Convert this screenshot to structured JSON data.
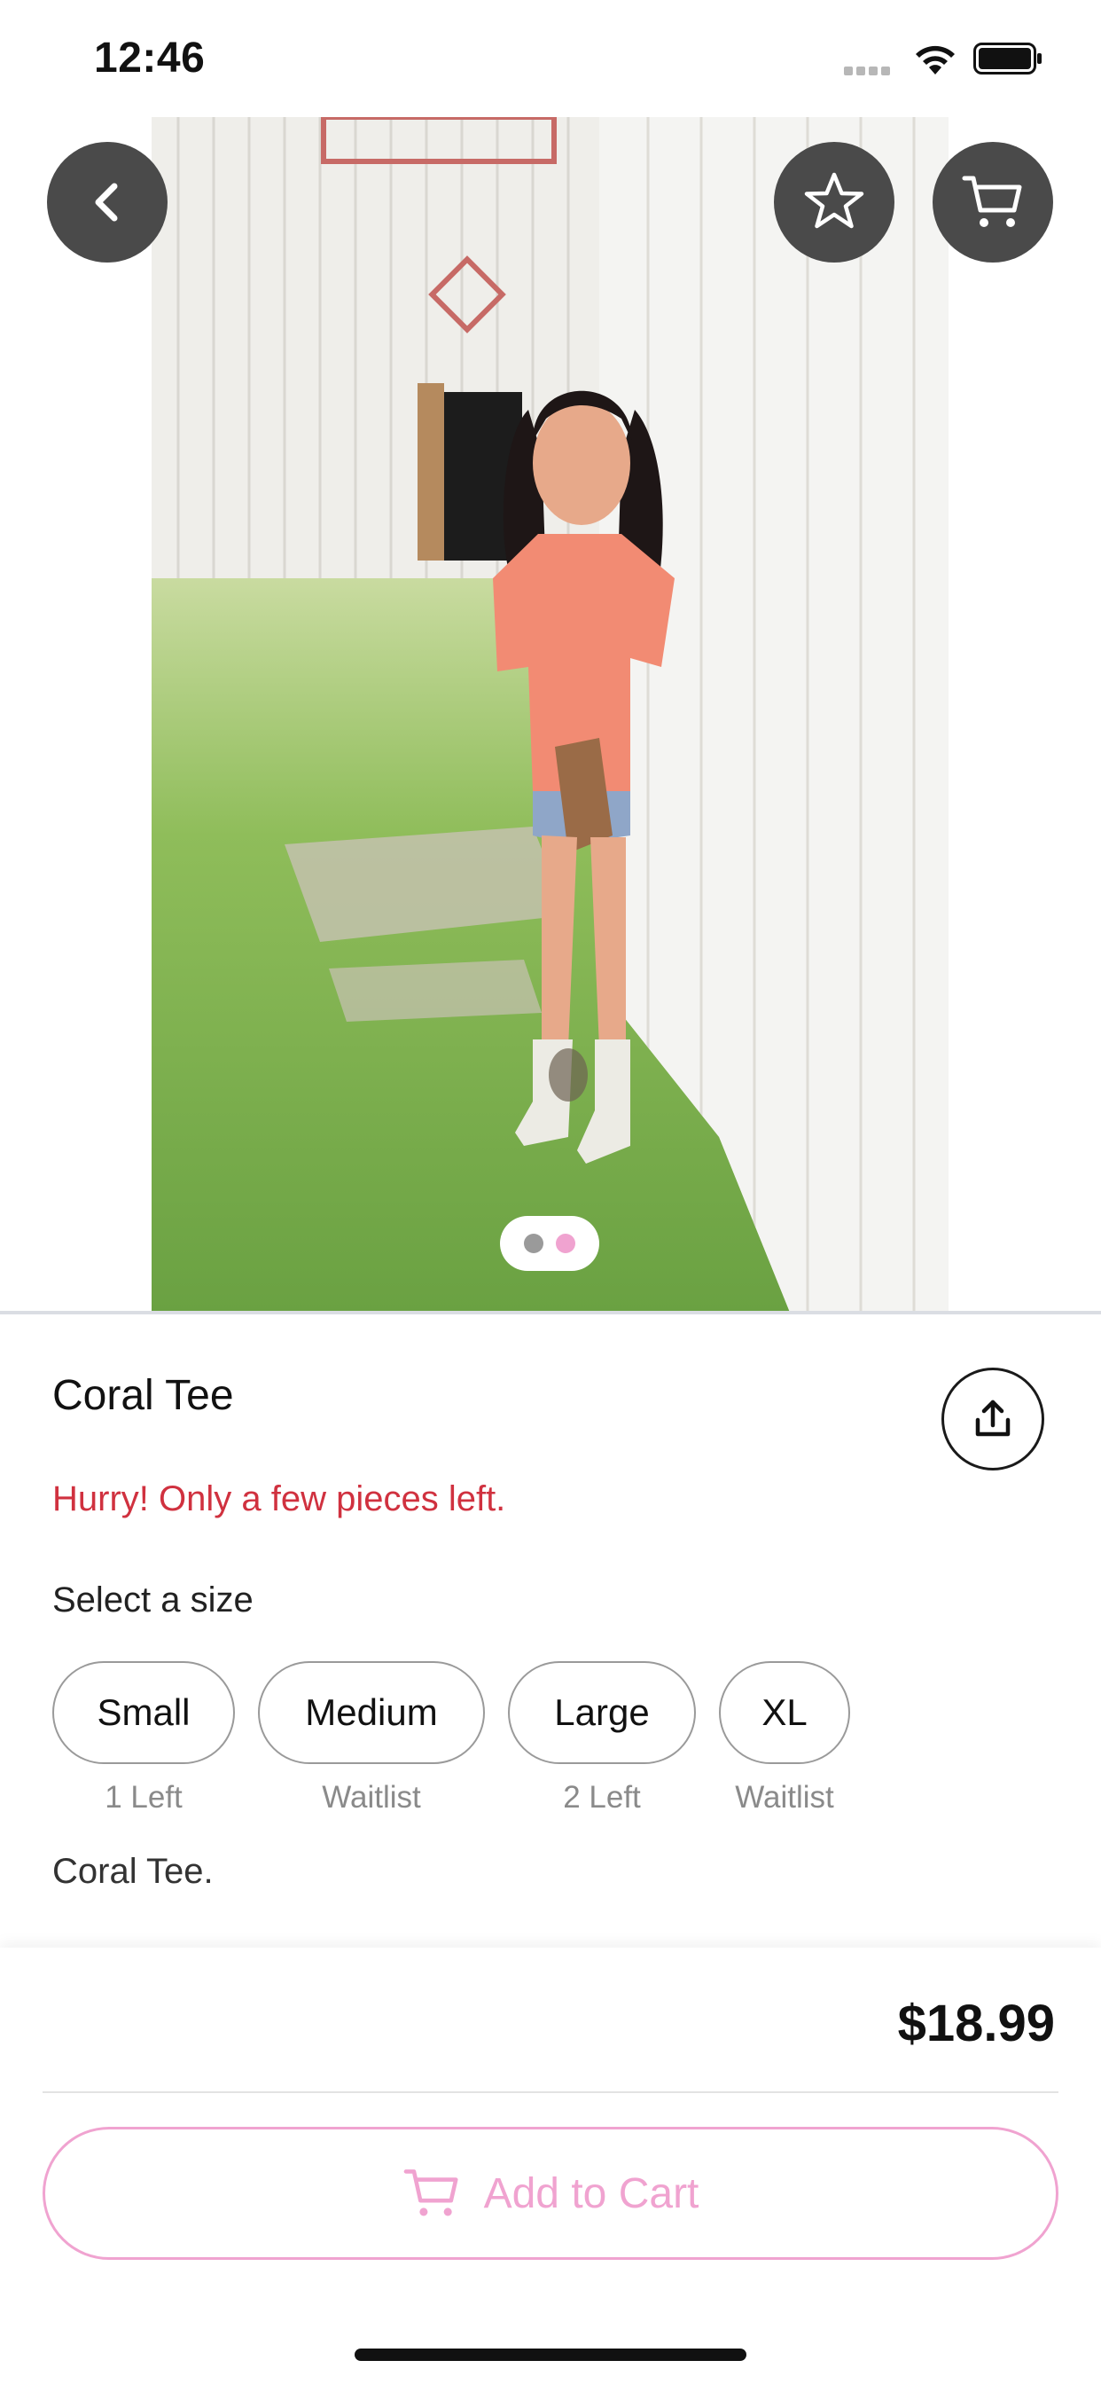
{
  "status_bar": {
    "time": "12:46"
  },
  "product": {
    "title": "Coral Tee",
    "stock_message": "Hurry! Only a few pieces left.",
    "size_prompt": "Select a size",
    "sizes": [
      {
        "label": "Small",
        "availability": "1 Left"
      },
      {
        "label": "Medium",
        "availability": "Waitlist"
      },
      {
        "label": "Large",
        "availability": "2 Left"
      },
      {
        "label": "XL",
        "availability": "Waitlist"
      }
    ],
    "description": "Coral Tee.",
    "image_pager": {
      "count": 2,
      "active_index": 1
    }
  },
  "checkout": {
    "price": "$18.99",
    "add_to_cart_label": "Add to Cart"
  },
  "icons": {
    "back": "chevron-left-icon",
    "favorite": "star-icon",
    "cart": "cart-icon",
    "share": "share-icon"
  },
  "colors": {
    "accent_pink": "#f0a3d0",
    "alert_red": "#d0313f",
    "overlay_button": "#4a4a4a",
    "pager_inactive": "#9a9a9a"
  }
}
